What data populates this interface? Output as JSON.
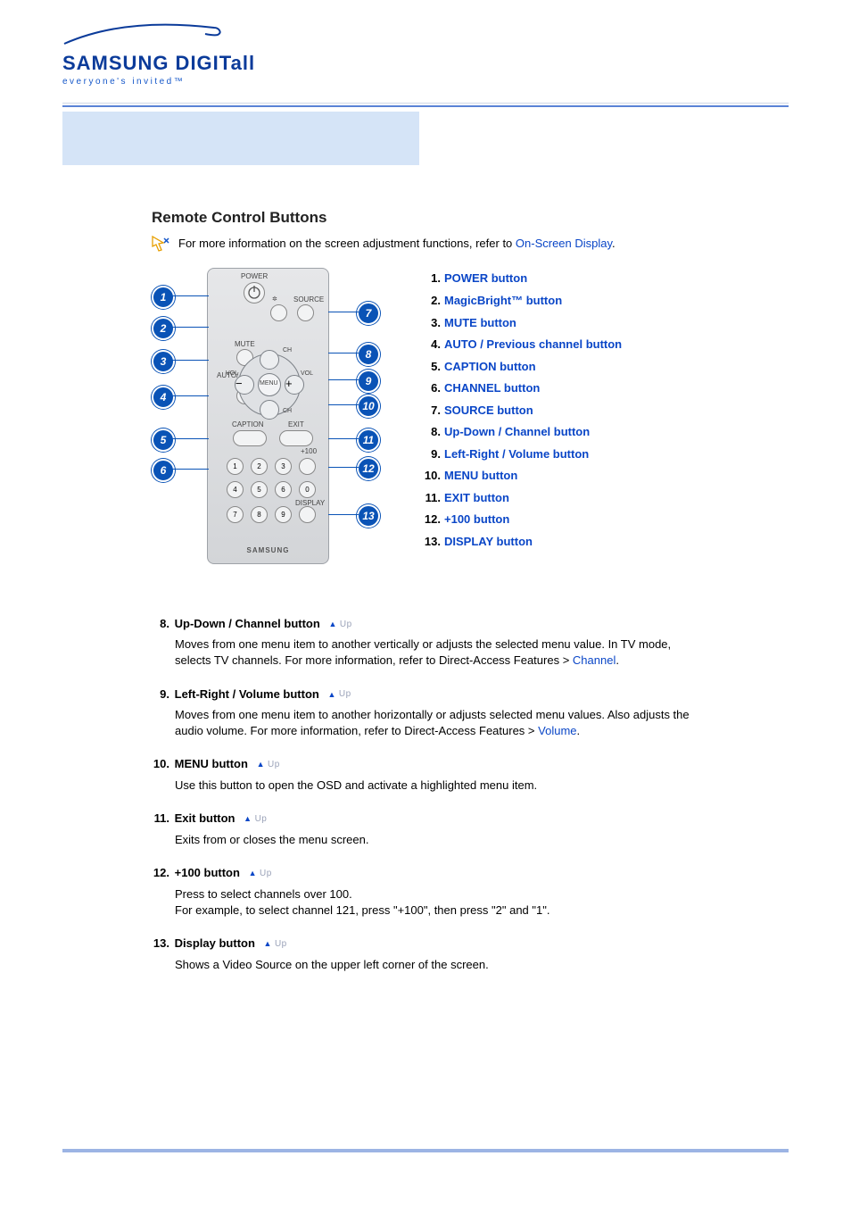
{
  "logo": {
    "brand": "SAMSUNG DIGITall",
    "tagline": "everyone's invited™"
  },
  "title": "Remote Control Buttons",
  "info_line": {
    "prefix": "For more information on the screen adjustment functions, refer to ",
    "link": "On-Screen Display",
    "suffix": "."
  },
  "callouts": [
    {
      "n": "1.",
      "t": "POWER button"
    },
    {
      "n": "2.",
      "t": "MagicBright™ button"
    },
    {
      "n": "3.",
      "t": "MUTE button"
    },
    {
      "n": "4.",
      "t": "AUTO / Previous channel button"
    },
    {
      "n": "5.",
      "t": "CAPTION button"
    },
    {
      "n": "6.",
      "t": "CHANNEL button"
    },
    {
      "n": "7.",
      "t": "SOURCE button"
    },
    {
      "n": "8.",
      "t": "Up-Down / Channel button"
    },
    {
      "n": "9.",
      "t": "Left-Right / Volume button"
    },
    {
      "n": "10.",
      "t": "MENU button"
    },
    {
      "n": "11.",
      "t": "EXIT button"
    },
    {
      "n": "12.",
      "t": "+100 button"
    },
    {
      "n": "13.",
      "t": "DISPLAY button"
    }
  ],
  "remote_labels": {
    "power": "POWER",
    "source": "SOURCE",
    "mute": "MUTE",
    "auto": "AUTO/\nPRE-CH",
    "caption": "CAPTION",
    "exit": "EXIT",
    "plus100": "+100",
    "display": "DISPLAY",
    "menu": "MENU",
    "vol": "VOL",
    "ch": "CH",
    "samsung": "SAMSUNG"
  },
  "details": [
    {
      "n": "8.",
      "title": "Up-Down / Channel button",
      "body_a": "Moves from one menu item to another vertically or adjusts the selected menu value. In TV mode, selects TV channels. For more information, refer to Direct-Access Features > ",
      "link": "Channel",
      "body_b": "."
    },
    {
      "n": "9.",
      "title": "Left-Right / Volume button",
      "body_a": "Moves from one menu item to another horizontally or adjusts selected menu values. Also adjusts the audio volume. For more information, refer to Direct-Access Features > ",
      "link": "Volume",
      "body_b": "."
    },
    {
      "n": "10.",
      "title": "MENU button",
      "body_a": "Use this button to open the OSD and activate a highlighted menu item.",
      "link": "",
      "body_b": ""
    },
    {
      "n": "11.",
      "title": "Exit button",
      "body_a": "Exits from or closes the menu screen.",
      "link": "",
      "body_b": ""
    },
    {
      "n": "12.",
      "title": "+100 button",
      "body_a": "Press to select channels over 100.\nFor example, to select channel 121, press \"+100\", then press \"2\" and \"1\".",
      "link": "",
      "body_b": ""
    },
    {
      "n": "13.",
      "title": "Display button",
      "body_a": "Shows a Video Source on the upper left corner of the screen.",
      "link": "",
      "body_b": ""
    }
  ],
  "up_label": "Up"
}
